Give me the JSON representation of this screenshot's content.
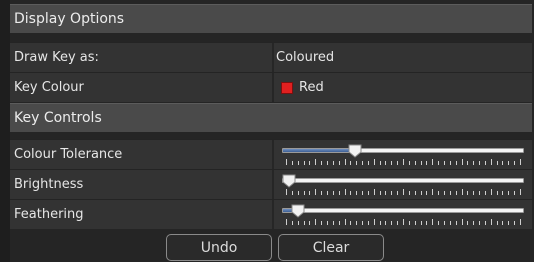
{
  "display_options": {
    "title": "Display Options",
    "draw_key": {
      "label": "Draw Key as:",
      "value": "Coloured"
    },
    "key_colour": {
      "label": "Key Colour",
      "value": "Red",
      "swatch_color": "#e02020"
    }
  },
  "key_controls": {
    "title": "Key Controls",
    "sliders": [
      {
        "label": "Colour Tolerance",
        "level": 0.29
      },
      {
        "label": "Brightness",
        "level": 0.0
      },
      {
        "label": "Feathering",
        "level": 0.04
      }
    ]
  },
  "buttons": {
    "undo": "Undo",
    "clear": "Clear"
  },
  "colors": {
    "header_bg": "#4a4a4a",
    "row_bg": "#333333",
    "slider_fill": "#4f72a8"
  }
}
